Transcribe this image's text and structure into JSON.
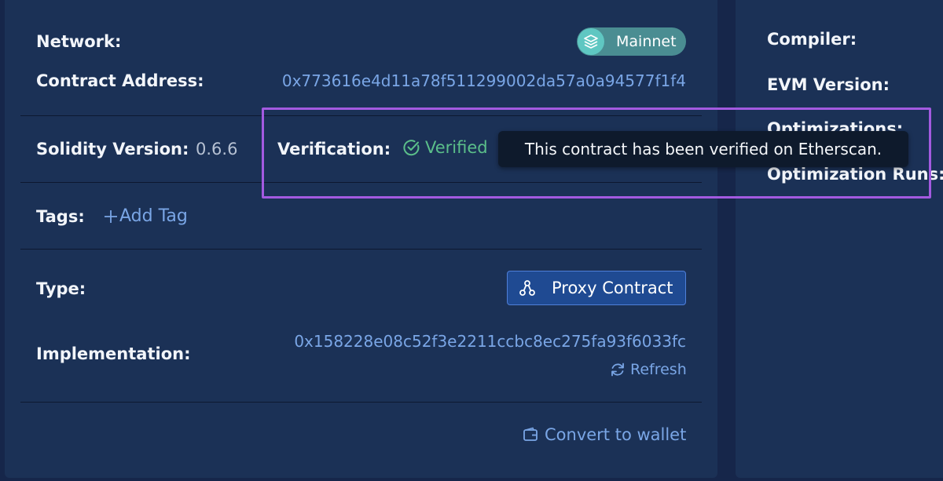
{
  "details": {
    "network_label": "Network:",
    "network_value": "Mainnet",
    "contract_address_label": "Contract Address:",
    "contract_address_value": "0x773616e4d11a78f511299002da57a0a94577f1f4",
    "solidity_version_label": "Solidity Version:",
    "solidity_version_value": "0.6.6",
    "verification_label": "Verification:",
    "verification_value": "Verified",
    "verification_tooltip": "This contract has been verified on Etherscan.",
    "tags_label": "Tags:",
    "add_tag_label": "Add Tag",
    "type_label": "Type:",
    "type_value": "Proxy Contract",
    "implementation_label": "Implementation:",
    "implementation_value": "0x158228e08c52f3e2211ccbc8ec275fa93f6033fc",
    "refresh_label": "Refresh",
    "convert_label": "Convert to wallet"
  },
  "side_panel": {
    "compiler_label": "Compiler:",
    "evm_version_label": "EVM Version:",
    "optimizations_label": "Optimizations:",
    "optimization_runs_label": "Optimization Runs:"
  },
  "icons": {
    "network": "layers-icon",
    "verified": "check-circle-icon",
    "add_tag": "plus-icon",
    "proxy": "proxy-icon",
    "refresh": "refresh-icon",
    "convert": "wallet-icon"
  },
  "colors": {
    "background": "#1b3156",
    "accent": "#7aa6e6",
    "verified": "#5bbf8a",
    "badge": "#4a8d92",
    "highlight": "#a35ae0"
  }
}
